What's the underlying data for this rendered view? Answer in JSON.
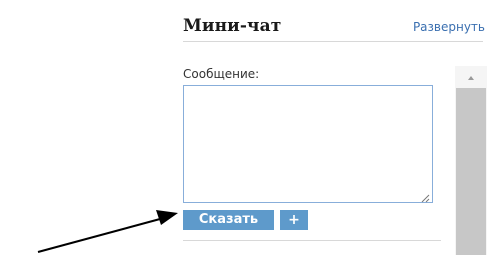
{
  "chat": {
    "title": "Мини-чат",
    "expand_label": "Развернуть",
    "message_label": "Сообщение:",
    "message_value": "",
    "say_button": "Сказать",
    "plus_button": "+"
  },
  "scrollbar": {
    "up_icon": "triangle-up-icon"
  },
  "colors": {
    "link": "#3a6fb0",
    "button_bg": "#5e9acb",
    "textarea_border": "#88aeda",
    "scroll_thumb": "#c7c7c7"
  }
}
